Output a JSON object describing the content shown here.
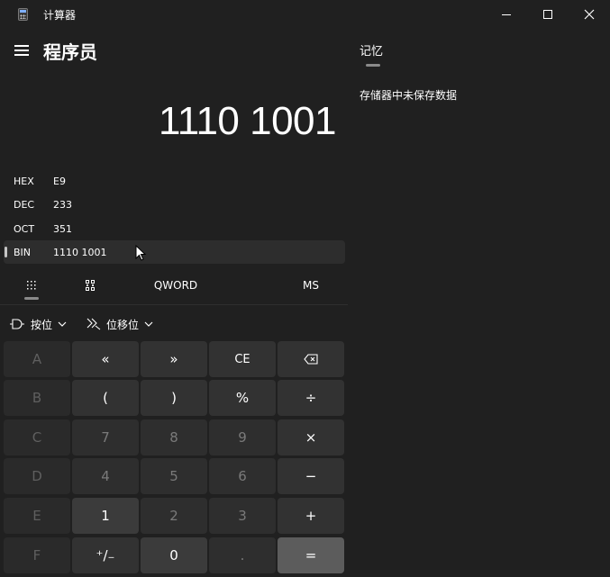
{
  "window": {
    "title": "计算器"
  },
  "header": {
    "mode_title": "程序员"
  },
  "display": {
    "value": "1110 1001"
  },
  "radix": [
    {
      "label": "HEX",
      "value": "E9"
    },
    {
      "label": "DEC",
      "value": "233"
    },
    {
      "label": "OCT",
      "value": "351"
    },
    {
      "label": "BIN",
      "value": "1110 1001"
    }
  ],
  "tools": {
    "word_size": "QWORD",
    "ms": "MS"
  },
  "dropdowns": {
    "bitwise": "按位",
    "bitshift": "位移位"
  },
  "keys": [
    [
      "A",
      "«",
      "»",
      "CE",
      "⌫"
    ],
    [
      "B",
      "(",
      ")",
      "%",
      "÷"
    ],
    [
      "C",
      "7",
      "8",
      "9",
      "×"
    ],
    [
      "D",
      "4",
      "5",
      "6",
      "−"
    ],
    [
      "E",
      "1",
      "2",
      "3",
      "+"
    ],
    [
      "F",
      "⁺/₋",
      "0",
      ".",
      "="
    ]
  ],
  "memory": {
    "title": "记忆",
    "empty_text": "存储器中未保存数据"
  }
}
